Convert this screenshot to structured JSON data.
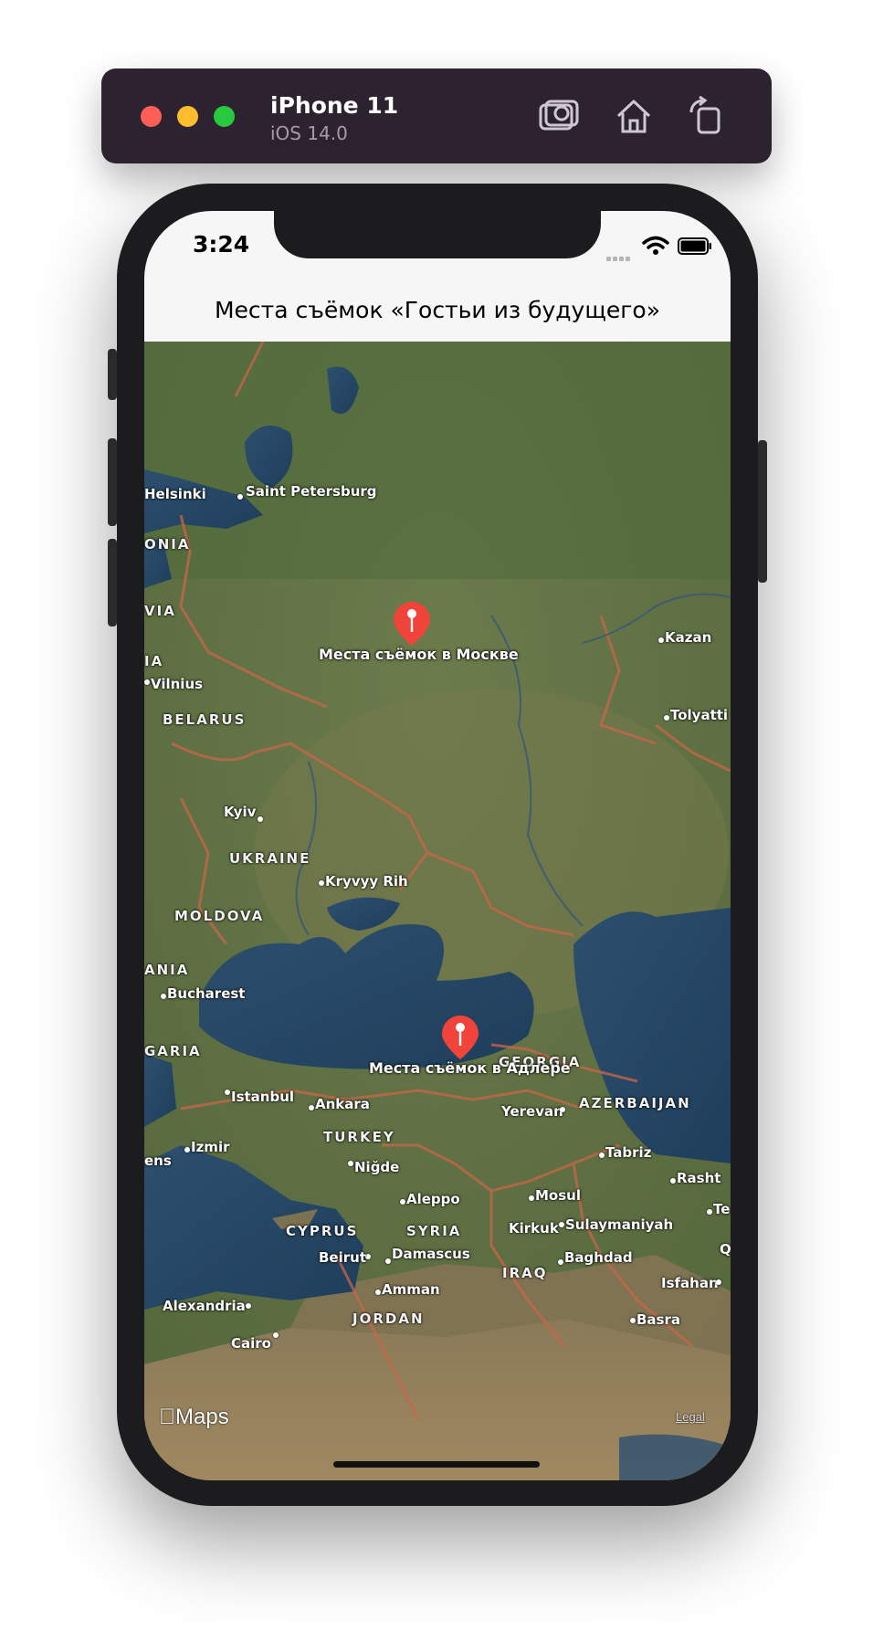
{
  "simulator": {
    "device_name": "iPhone 11",
    "os_version": "iOS 14.0",
    "toolbar_icons": [
      "screenshot-icon",
      "home-icon",
      "rotate-icon"
    ]
  },
  "status_bar": {
    "time": "3:24",
    "icons": [
      "signal-icon",
      "wifi-icon",
      "battery-icon"
    ]
  },
  "nav": {
    "title": "Места съёмок «Гостьи из будущего»"
  },
  "map": {
    "type": "satellite",
    "annotations": [
      {
        "label": "Места съёмок в Москве",
        "color": "#f0443a"
      },
      {
        "label": "Места съёмок в Адлере",
        "color": "#f0443a"
      }
    ],
    "cities": [
      "Helsinki",
      "Saint Petersburg",
      "Kazan",
      "Vilnius",
      "Tolyatti",
      "Kyiv",
      "Kryvyy Rih",
      "Bucharest",
      "Istanbul",
      "Ankara",
      "Yerevan",
      "Izmir",
      "Tabriz",
      "Niğde",
      "Rasht",
      "Aleppo",
      "Mosul",
      "Te",
      "Kirkuk",
      "Sulaymaniyah",
      "Qom",
      "Beirut",
      "Damascus",
      "Baghdad",
      "Isfahan",
      "Amman",
      "Alexandria",
      "Basra",
      "Cairo",
      "ens"
    ],
    "countries": [
      "ONIA",
      "VIA",
      "IA",
      "BELARUS",
      "UKRAINE",
      "MOLDOVA",
      "ANIA",
      "GARIA",
      "GEORGIA",
      "AZERBAIJAN",
      "TURKEY",
      "CYPRUS",
      "SYRIA",
      "IRAQ",
      "JORDAN"
    ],
    "attribution": "Maps",
    "legal": "Legal"
  }
}
